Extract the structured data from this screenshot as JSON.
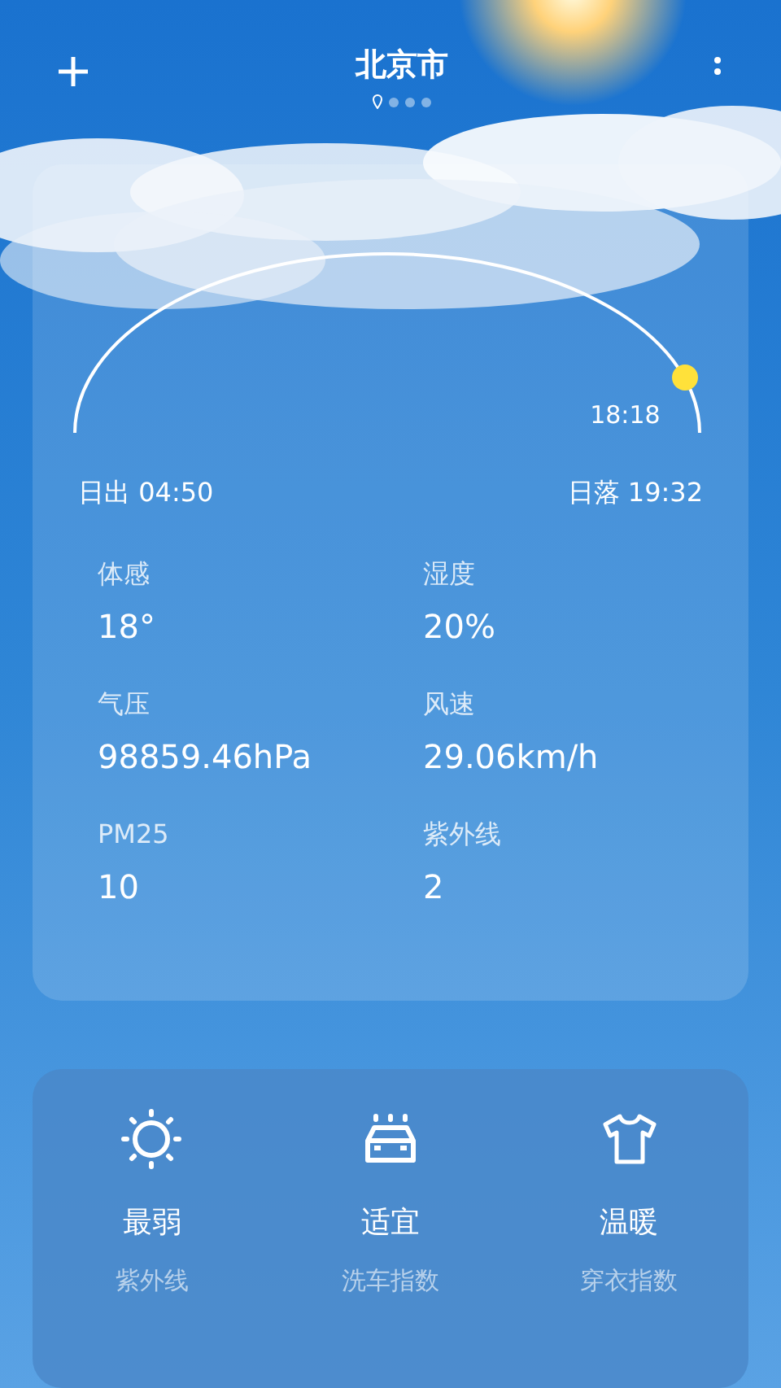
{
  "header": {
    "title": "北京市"
  },
  "page_indicator": [
    {
      "kind": "location",
      "selected": true
    },
    {
      "kind": "dot",
      "selected": false
    },
    {
      "kind": "dot",
      "selected": false
    },
    {
      "kind": "dot",
      "selected": false
    }
  ],
  "sun_path": {
    "current_time": "18:18",
    "sunrise": "日出 04:50",
    "sunset": "日落 19:32"
  },
  "details": [
    {
      "label": "体感",
      "value": "18°"
    },
    {
      "label": "湿度",
      "value": "20%"
    },
    {
      "label": "气压",
      "value": "98859.46hPa"
    },
    {
      "label": "风速",
      "value": "29.06km/h"
    },
    {
      "label": "PM25",
      "value": "10"
    },
    {
      "label": "紫外线",
      "value": "2"
    }
  ],
  "indices": [
    {
      "kind": "uv",
      "value": "最弱",
      "label": "紫外线"
    },
    {
      "kind": "car_wash",
      "value": "适宜",
      "label": "洗车指数"
    },
    {
      "kind": "clothing",
      "value": "温暖",
      "label": "穿衣指数"
    }
  ]
}
